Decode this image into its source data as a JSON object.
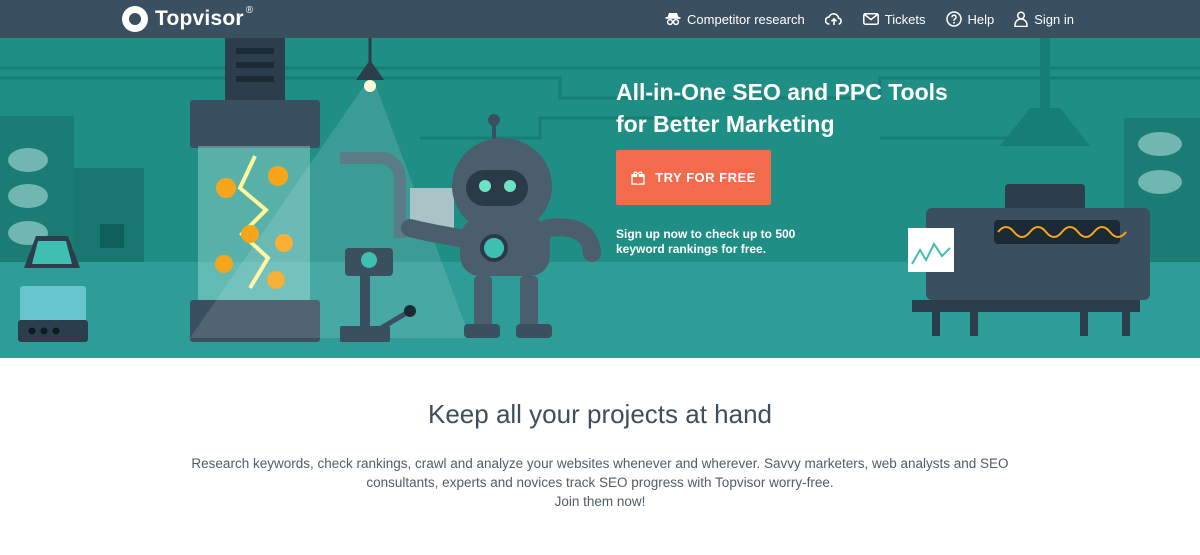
{
  "header": {
    "brand": "Topvisor",
    "registered": "®",
    "nav": [
      {
        "icon": "spy-icon",
        "label": "Competitor research"
      },
      {
        "icon": "cloud-upload-icon",
        "label": ""
      },
      {
        "icon": "envelope-icon",
        "label": "Tickets"
      },
      {
        "icon": "question-circle-icon",
        "label": "Help"
      },
      {
        "icon": "user-icon",
        "label": "Sign in"
      }
    ]
  },
  "hero": {
    "title_line1": "All-in-One SEO and PPC Tools",
    "title_line2": "for Better Marketing",
    "cta_label": "TRY FOR FREE",
    "cta_icon": "gift-icon",
    "subtext_line1": "Sign up now to check up to 500",
    "subtext_line2": "keyword rankings for free."
  },
  "section": {
    "title": "Keep all your projects at hand",
    "text_line1": "Research keywords, check rankings, crawl and analyze your websites whenever and wherever. Savvy marketers, web analysts and SEO",
    "text_line2": "consultants, experts and novices track SEO progress with Topvisor worry-free.",
    "text_line3": "Join them now!"
  },
  "colors": {
    "header_bg": "#3a4f5f",
    "hero_bg": "#1f8f86",
    "cta": "#f26b4c",
    "title_text": "#3d4f5c"
  }
}
